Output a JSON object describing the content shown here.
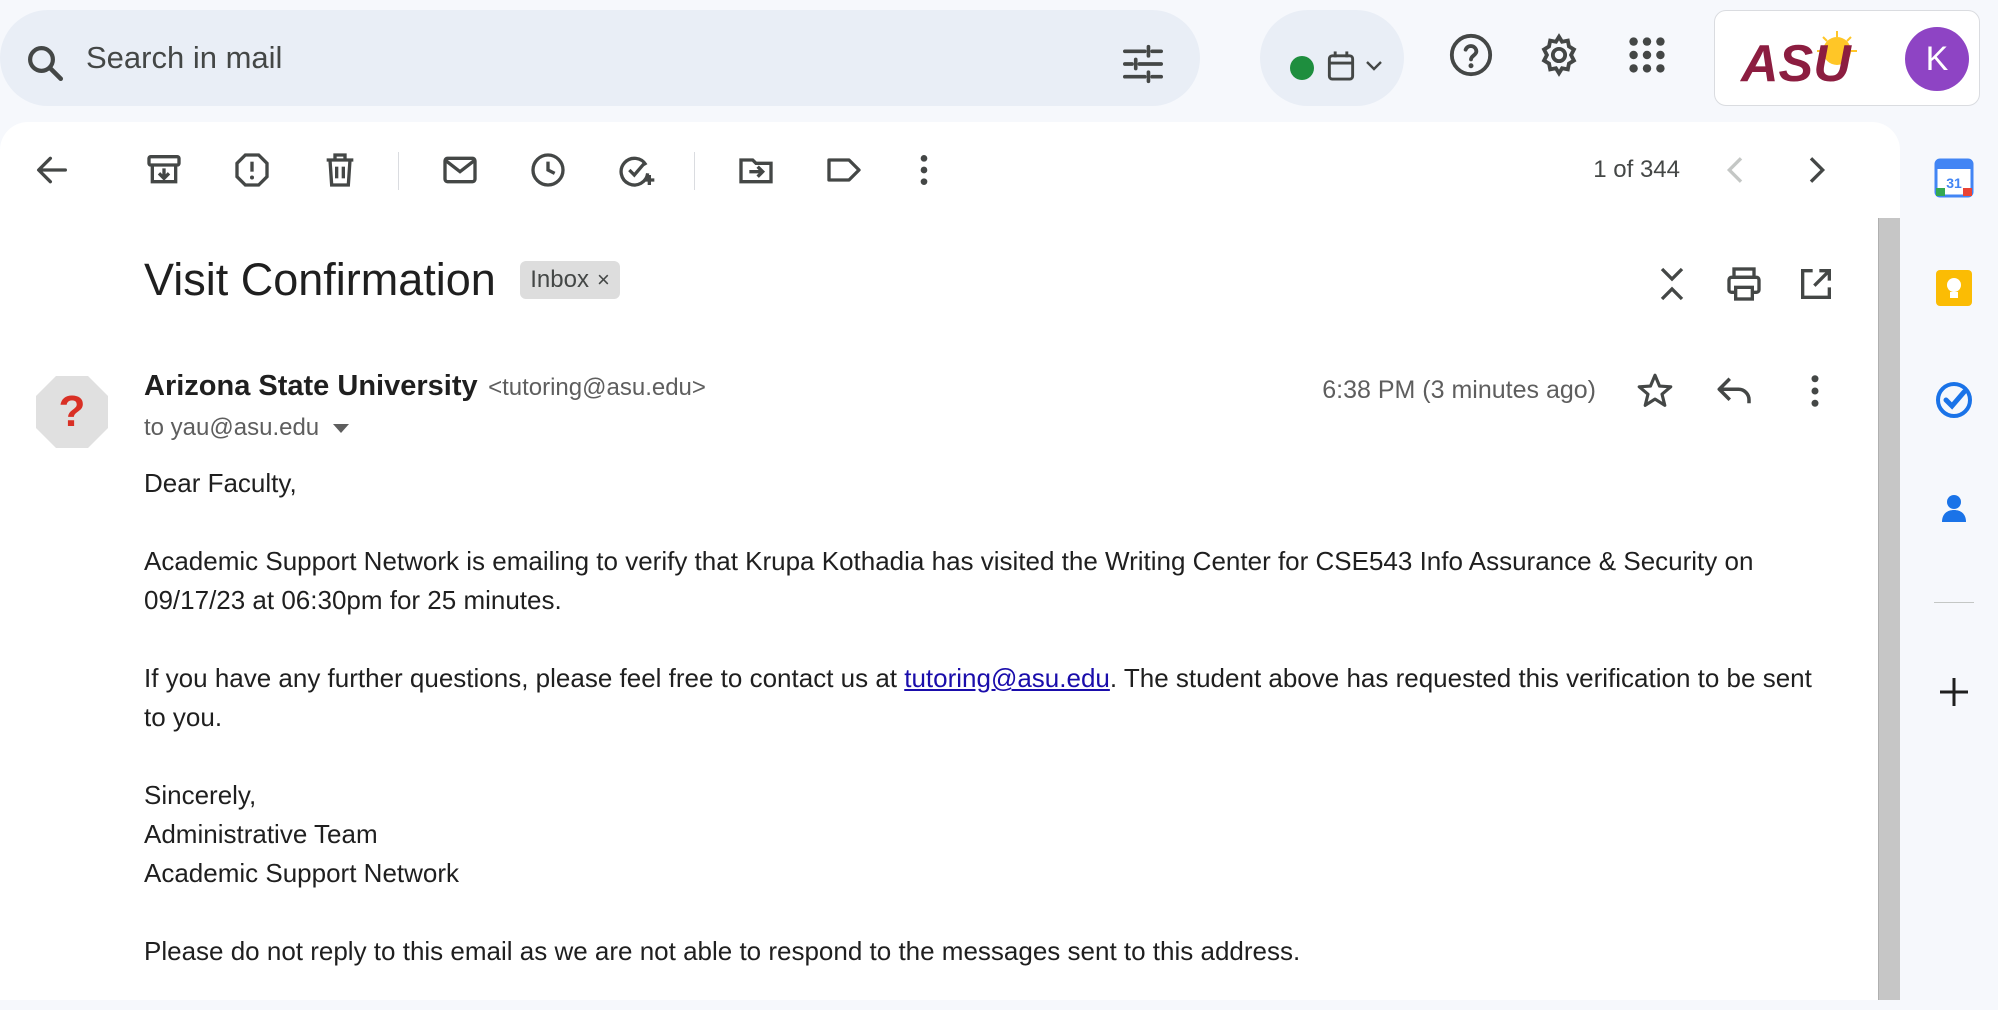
{
  "search": {
    "placeholder": "Search in mail"
  },
  "account": {
    "logo_text": "ASU",
    "avatar_letter": "K"
  },
  "pager": {
    "text": "1 of 344"
  },
  "email": {
    "subject": "Visit Confirmation",
    "label": "Inbox",
    "label_remove": "×",
    "sender_name": "Arizona State University",
    "sender_email": "<tutoring@asu.edu>",
    "to": "to yau@asu.edu",
    "timestamp": "6:38 PM (3 minutes ago)",
    "body": {
      "greeting": "Dear Faculty,",
      "para1": "Academic Support Network is emailing to verify that Krupa Kothadia has visited the Writing Center for CSE543 Info Assurance & Security on 09/17/23 at 06:30pm for 25 minutes.",
      "para2_before": "If you have any further questions, please feel free to contact us at ",
      "para2_link": "tutoring@asu.edu",
      "para2_after": ". The student above has requested this verification to be sent to you.",
      "sign1": "Sincerely,",
      "sign2": "Administrative Team",
      "sign3": "Academic Support Network",
      "footer": "Please do not reply to this email as we are not able to respond to the messages sent to this address."
    }
  },
  "side_apps": {
    "calendar_day": "31"
  },
  "colors": {
    "accent": "#0b57d0",
    "status_green": "#1e8e3e",
    "asu_maroon": "#8c1d40",
    "asu_gold": "#ffc627",
    "avatar": "#8e44c4",
    "link": "#1a0dab"
  },
  "icons": {
    "top": [
      "search-icon",
      "filter-icon",
      "calendar-icon",
      "help-icon",
      "settings-icon",
      "apps-icon"
    ],
    "toolbar": [
      "back-arrow-icon",
      "archive-icon",
      "report-spam-icon",
      "delete-icon",
      "mark-unread-icon",
      "snooze-icon",
      "add-task-icon",
      "move-to-icon",
      "label-icon",
      "more-vert-icon",
      "chevron-left-icon",
      "chevron-right-icon"
    ],
    "subject": [
      "collapse-icon",
      "print-icon",
      "open-new-window-icon"
    ],
    "message": [
      "star-icon",
      "reply-icon",
      "more-vert-icon"
    ],
    "side": [
      "google-calendar-icon",
      "google-keep-icon",
      "google-tasks-icon",
      "google-contacts-icon",
      "plus-icon"
    ]
  }
}
